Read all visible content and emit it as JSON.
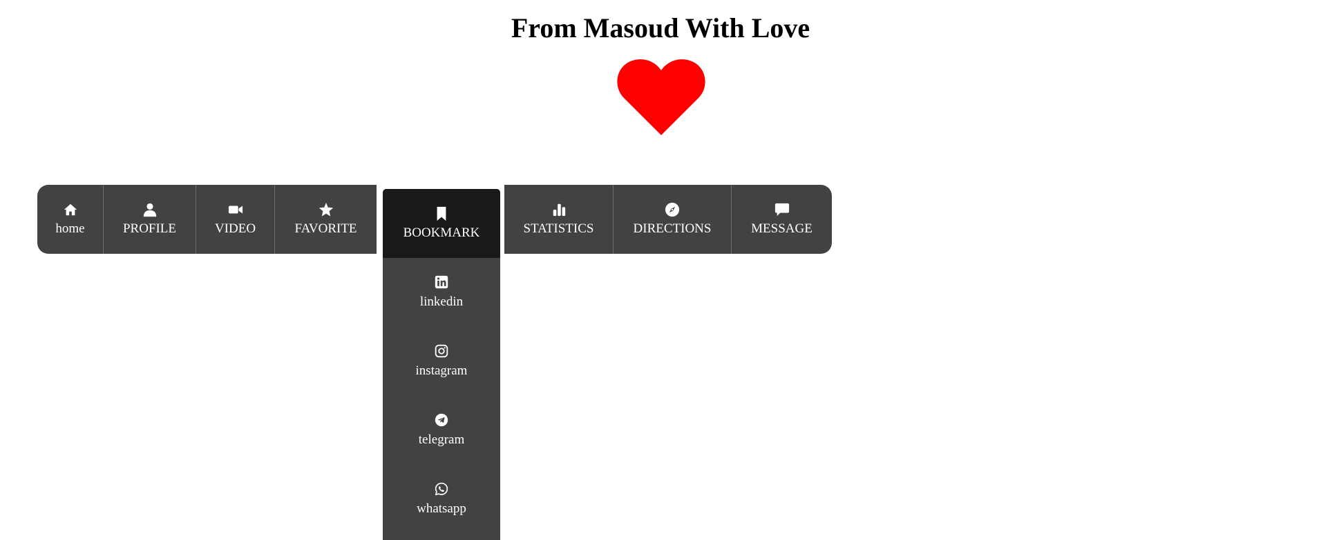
{
  "header": {
    "title": "From Masoud With Love"
  },
  "heart": {
    "color": "#ff0000",
    "icon": "heart-icon"
  },
  "nav": {
    "items": [
      {
        "label": "home",
        "icon": "home-icon"
      },
      {
        "label": "PROFILE",
        "icon": "user-icon"
      },
      {
        "label": "VIDEO",
        "icon": "video-camera-icon"
      },
      {
        "label": "FAVORITE",
        "icon": "star-icon"
      },
      {
        "label": "BOOKMARK",
        "icon": "bookmark-icon",
        "active": true
      },
      {
        "label": "STATISTICS",
        "icon": "bar-chart-icon"
      },
      {
        "label": "DIRECTIONS",
        "icon": "compass-icon"
      },
      {
        "label": "MESSAGE",
        "icon": "message-icon"
      }
    ]
  },
  "dropdown": {
    "items": [
      {
        "label": "linkedin",
        "icon": "linkedin-icon"
      },
      {
        "label": "instagram",
        "icon": "instagram-icon"
      },
      {
        "label": "telegram",
        "icon": "telegram-icon"
      },
      {
        "label": "whatsapp",
        "icon": "whatsapp-icon"
      }
    ]
  },
  "colors": {
    "nav_bg": "#424242",
    "active_bg": "#1b1918",
    "text": "#ffffff"
  }
}
